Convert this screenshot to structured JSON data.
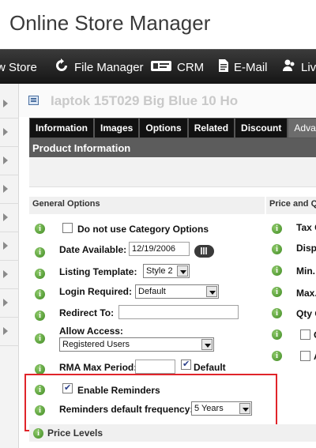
{
  "app": {
    "title": "Online Store Manager"
  },
  "nav": {
    "store": "w Store",
    "file_manager": "File Manager",
    "crm": "CRM",
    "email": "E-Mail",
    "live": "Liv"
  },
  "product": {
    "name": "Iaptok 15T029 Big Blue 10 Ho"
  },
  "tabs": [
    "Information",
    "Images",
    "Options",
    "Related",
    "Discount",
    "Advan"
  ],
  "section": {
    "title": "Product Information"
  },
  "general": {
    "header": "General Options",
    "no_category_label": "Do not use Category Options",
    "date_label": "Date Available:",
    "date_value": "12/19/2006",
    "template_label": "Listing Template:",
    "template_value": "Style 2",
    "login_label": "Login Required:",
    "login_value": "Default",
    "redirect_label": "Redirect To:",
    "redirect_value": "",
    "access_label": "Allow Access:",
    "access_value": "Registered Users",
    "rma_label": "RMA Max Period:",
    "rma_value": "",
    "rma_default_label": "Default",
    "reminders_label": "Enable Reminders",
    "frequency_label": "Reminders default frequency:",
    "frequency_value": "5 Years"
  },
  "price": {
    "header": "Price and Q",
    "tax": "Tax C",
    "display": "Displ",
    "min": "Min.",
    "max": "Max.",
    "qty": "Qty C",
    "check1": "C",
    "check2": "A"
  },
  "footer": {
    "price_levels": "Price Levels"
  }
}
